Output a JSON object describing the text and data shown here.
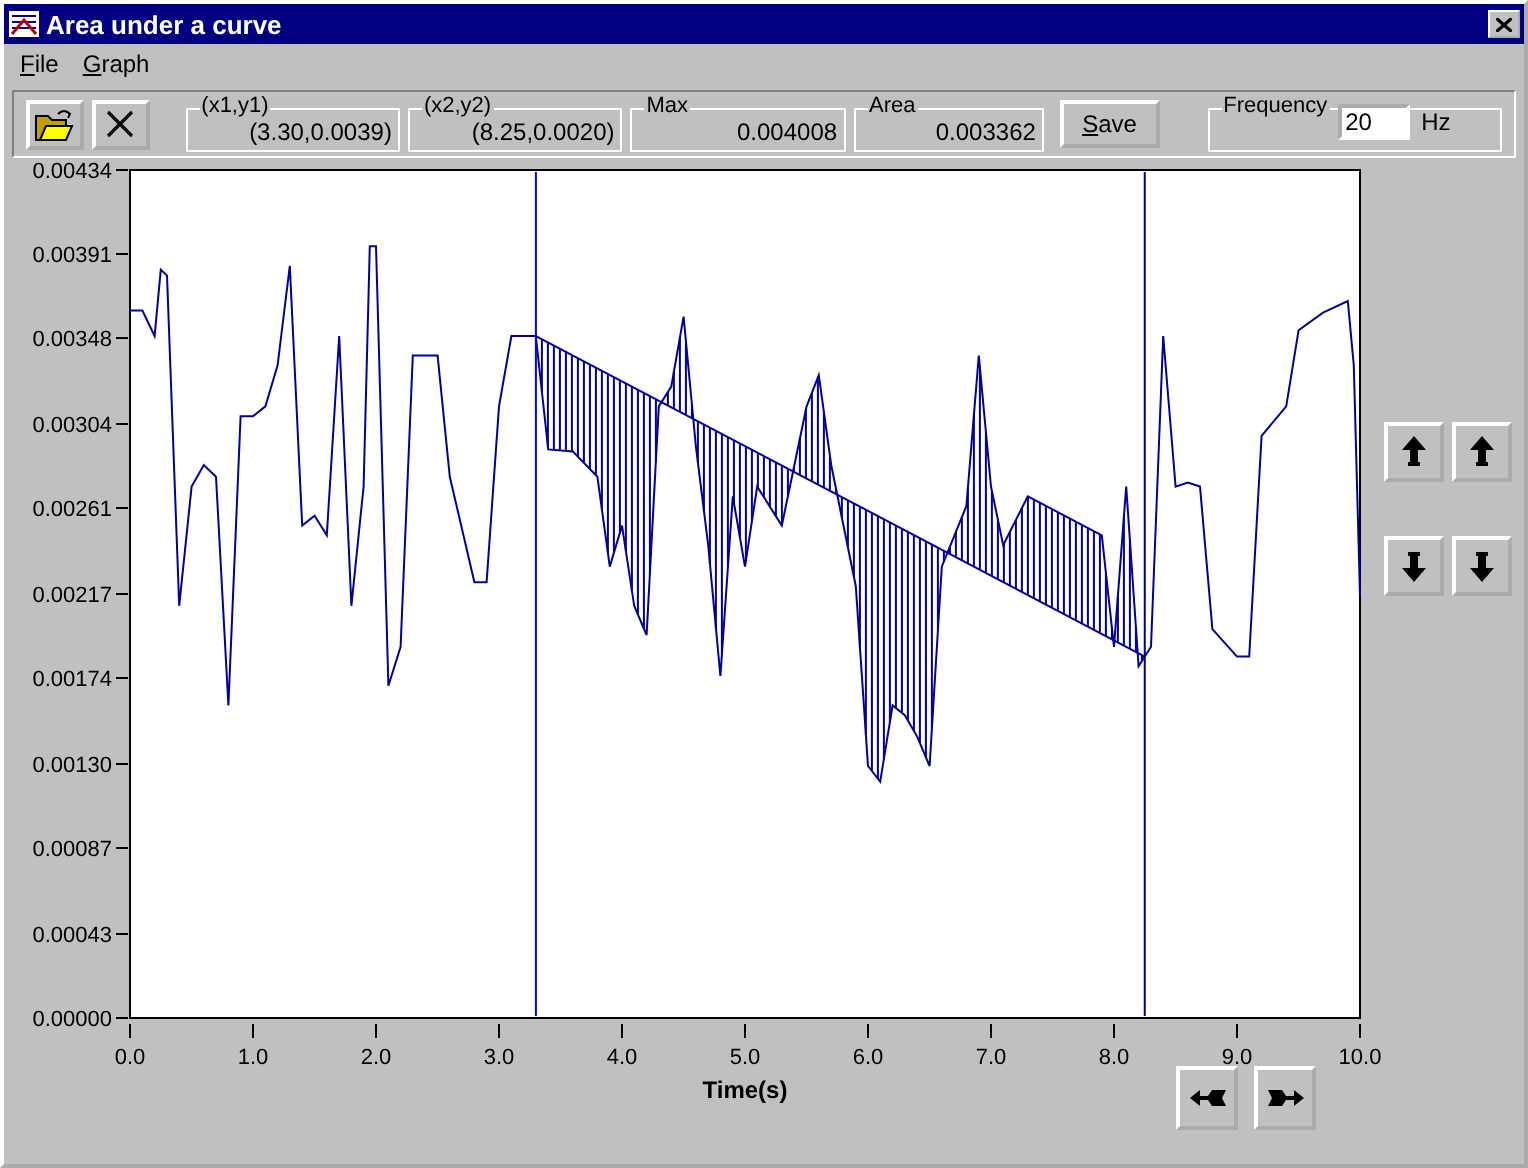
{
  "window": {
    "title": "Area under a curve"
  },
  "menu": [
    "File",
    "Graph"
  ],
  "readouts": [
    {
      "label": "(x1,y1)",
      "value": "(3.30,0.0039)"
    },
    {
      "label": "(x2,y2)",
      "value": "(8.25,0.0020)"
    },
    {
      "label": "Max",
      "value": "0.004008"
    },
    {
      "label": "Area",
      "value": "0.003362"
    }
  ],
  "save_button": "Save",
  "frequency": {
    "label": "Frequency",
    "value": "20",
    "unit": "Hz"
  },
  "chart_data": {
    "type": "line",
    "xlabel": "Time(s)",
    "x": [
      0,
      0.1,
      0.2,
      0.25,
      0.3,
      0.4,
      0.5,
      0.6,
      0.7,
      0.8,
      0.9,
      1.0,
      1.1,
      1.2,
      1.3,
      1.4,
      1.5,
      1.6,
      1.7,
      1.8,
      1.9,
      1.95,
      2.0,
      2.1,
      2.2,
      2.3,
      2.5,
      2.6,
      2.8,
      2.9,
      3.0,
      3.1,
      3.3,
      3.4,
      3.6,
      3.8,
      3.9,
      4.0,
      4.1,
      4.2,
      4.3,
      4.4,
      4.5,
      4.6,
      4.7,
      4.8,
      4.9,
      5.0,
      5.1,
      5.3,
      5.5,
      5.6,
      5.7,
      5.9,
      6.0,
      6.1,
      6.2,
      6.3,
      6.4,
      6.5,
      6.6,
      6.8,
      6.9,
      7.0,
      7.1,
      7.3,
      7.6,
      7.9,
      8.0,
      8.1,
      8.2,
      8.3,
      8.4,
      8.5,
      8.6,
      8.7,
      8.8,
      9.0,
      9.1,
      9.2,
      9.4,
      9.5,
      9.7,
      9.9,
      9.95,
      10.0
    ],
    "series": [
      {
        "color": "#0000a0",
        "values": [
          0.00362,
          0.00362,
          0.00349,
          0.00383,
          0.0038,
          0.00211,
          0.00272,
          0.00283,
          0.00277,
          0.0016,
          0.00308,
          0.00308,
          0.00313,
          0.00334,
          0.00385,
          0.00252,
          0.00257,
          0.00247,
          0.00349,
          0.00211,
          0.00272,
          0.00395,
          0.00395,
          0.0017,
          0.0019,
          0.00339,
          0.00339,
          0.00277,
          0.00223,
          0.00223,
          0.00313,
          0.00349,
          0.00349,
          0.00291,
          0.0029,
          0.00277,
          0.00231,
          0.00252,
          0.00211,
          0.00196,
          0.00313,
          0.00323,
          0.00359,
          0.00293,
          0.00242,
          0.00175,
          0.00267,
          0.00231,
          0.00272,
          0.00252,
          0.00313,
          0.00329,
          0.00283,
          0.00221,
          0.00129,
          0.00121,
          0.0016,
          0.00155,
          0.00144,
          0.00129,
          0.00231,
          0.00262,
          0.00339,
          0.00272,
          0.00242,
          0.00267,
          0.00257,
          0.00247,
          0.0019,
          0.00272,
          0.0018,
          0.0019,
          0.00349,
          0.00272,
          0.00274,
          0.00272,
          0.00199,
          0.00185,
          0.00185,
          0.00298,
          0.00313,
          0.00352,
          0.00361,
          0.00367,
          0.00334,
          0.00216
        ]
      }
    ],
    "xlim": [
      0,
      10
    ],
    "ylim": [
      0,
      0.00434
    ],
    "xticks": [
      {
        "value": 0,
        "label": "0.0"
      },
      {
        "value": 1,
        "label": "1.0"
      },
      {
        "value": 2,
        "label": "2.0"
      },
      {
        "value": 3,
        "label": "3.0"
      },
      {
        "value": 4,
        "label": "4.0"
      },
      {
        "value": 5,
        "label": "5.0"
      },
      {
        "value": 6,
        "label": "6.0"
      },
      {
        "value": 7,
        "label": "7.0"
      },
      {
        "value": 8,
        "label": "8.0"
      },
      {
        "value": 9,
        "label": "9.0"
      },
      {
        "value": 10,
        "label": "10.0"
      }
    ],
    "yticks": [
      {
        "value": 0,
        "label": "0.00000"
      },
      {
        "value": 0.00043,
        "label": "0.00043"
      },
      {
        "value": 0.00087,
        "label": "0.00087"
      },
      {
        "value": 0.0013,
        "label": "0.00130"
      },
      {
        "value": 0.00174,
        "label": "0.00174"
      },
      {
        "value": 0.00217,
        "label": "0.00217"
      },
      {
        "value": 0.00261,
        "label": "0.00261"
      },
      {
        "value": 0.00304,
        "label": "0.00304"
      },
      {
        "value": 0.00348,
        "label": "0.00348"
      },
      {
        "value": 0.00391,
        "label": "0.00391"
      },
      {
        "value": 0.00434,
        "label": "0.00434"
      }
    ],
    "ref_lines": [
      {
        "axis": "x",
        "value": 3.3,
        "color": "#0000ff"
      },
      {
        "axis": "x",
        "value": 8.25,
        "color": "#000080"
      }
    ]
  }
}
